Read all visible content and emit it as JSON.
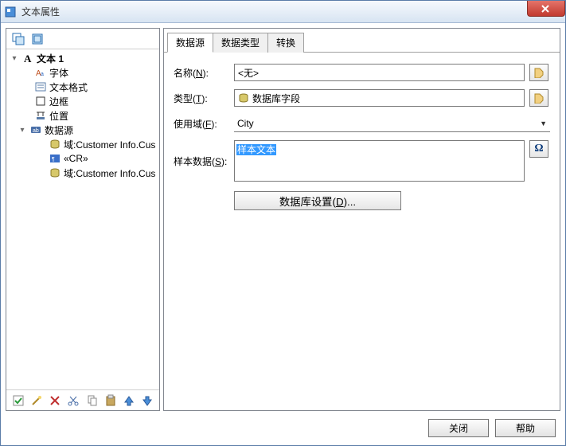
{
  "window": {
    "title": "文本属性"
  },
  "tree": {
    "root_label": "文本 1",
    "items": [
      {
        "label": "字体",
        "icon": "font-icon"
      },
      {
        "label": "文本格式",
        "icon": "textformat-icon"
      },
      {
        "label": "边框",
        "icon": "border-icon"
      },
      {
        "label": "位置",
        "icon": "position-icon"
      },
      {
        "label": "数据源",
        "icon": "datasource-icon"
      }
    ],
    "ds_children": [
      {
        "label": "域:Customer Info.Cus",
        "icon": "db-icon"
      },
      {
        "label": "«CR»",
        "icon": "cr-icon"
      },
      {
        "label": "域:Customer Info.Cus",
        "icon": "db-icon"
      }
    ]
  },
  "tabs": [
    {
      "label": "数据源",
      "active": true
    },
    {
      "label": "数据类型",
      "active": false
    },
    {
      "label": "转换",
      "active": false
    }
  ],
  "form": {
    "name_label": "名称(N):",
    "name_value": "<无>",
    "type_label": "类型(T):",
    "type_value": "数据库字段",
    "domain_label": "使用域(F):",
    "domain_value": "City",
    "sample_label": "样本数据(S):",
    "sample_value": "样本文本",
    "settings_btn": "数据库设置(D)..."
  },
  "footer": {
    "close": "关闭",
    "help": "帮助"
  }
}
